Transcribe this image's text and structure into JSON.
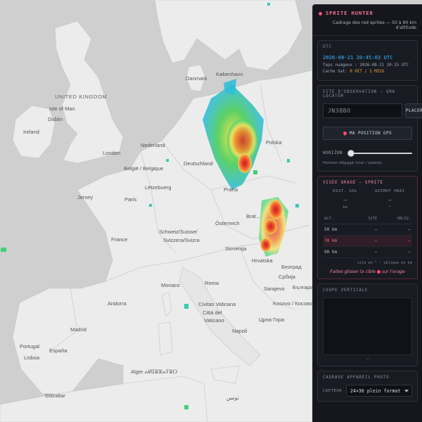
{
  "map": {
    "countries": [
      {
        "id": "uk",
        "label": "UNITED KINGDOM"
      },
      {
        "id": "ireland",
        "label": "Ireland"
      },
      {
        "id": "danmark",
        "label": "Danmark"
      },
      {
        "id": "nederland",
        "label": "Nederland"
      },
      {
        "id": "belgie",
        "label": "België / Belgique"
      },
      {
        "id": "deutschland",
        "label": "Deutschland"
      },
      {
        "id": "polska",
        "label": "Polska"
      },
      {
        "id": "letzebuerg",
        "label": "Lëtzebuerg"
      },
      {
        "id": "france",
        "label": "France"
      },
      {
        "id": "schweiz",
        "label": "Schweiz/Suisse/"
      },
      {
        "id": "svizzera",
        "label": "Svizzera/Svizra"
      },
      {
        "id": "osterreich",
        "label": "Österreich"
      },
      {
        "id": "slovenija",
        "label": "Slovenija"
      },
      {
        "id": "hrvatska",
        "label": "Hrvatska"
      },
      {
        "id": "srbija",
        "label": "Србија"
      },
      {
        "id": "monaco",
        "label": "Monaco"
      },
      {
        "id": "andorra",
        "label": "Andorra"
      },
      {
        "id": "portugal",
        "label": "Portugal"
      },
      {
        "id": "espana",
        "label": "España"
      },
      {
        "id": "civitas",
        "label": "Civitas Vaticana"
      },
      {
        "id": "citta",
        "label": "Città del"
      },
      {
        "id": "vaticano",
        "label": "Vaticano"
      },
      {
        "id": "kosovo",
        "label": "Kosovo / Косово"
      },
      {
        "id": "crnagora",
        "label": "Црна Гора"
      },
      {
        "id": "bulgaria",
        "label": "България"
      },
      {
        "id": "algerie",
        "label": "Alger ⴰⵍⵊⴻⵣⴰⵢⴻⵔ"
      },
      {
        "id": "tunis",
        "label": "تونس"
      }
    ],
    "cities": [
      {
        "id": "kobenhavn",
        "label": "København"
      },
      {
        "id": "isle",
        "label": "Isle of Man"
      },
      {
        "id": "dublin",
        "label": "Dublin"
      },
      {
        "id": "london",
        "label": "London"
      },
      {
        "id": "jersey",
        "label": "Jersey"
      },
      {
        "id": "paris",
        "label": "Paris"
      },
      {
        "id": "praha",
        "label": "Praha"
      },
      {
        "id": "bratislava",
        "label": "Brat..."
      },
      {
        "id": "roma",
        "label": "Roma"
      },
      {
        "id": "madrid",
        "label": "Madrid"
      },
      {
        "id": "lisboa",
        "label": "Lisboa"
      },
      {
        "id": "sarajevo",
        "label": "Sarajevo"
      },
      {
        "id": "beograd",
        "label": "Београд"
      },
      {
        "id": "gibraltar",
        "label": "Gibraltar"
      },
      {
        "id": "napoli",
        "label": "Napoli"
      }
    ]
  },
  "panel": {
    "title": "SPRITE HUNTER",
    "subtitle": "Cadrage des red sprites — 50 à 90 km d'altitude",
    "utc": {
      "section": "UTC",
      "time": "2026-08-21 20:45:03 UTC",
      "clouds": "Tops nuageux : 2026-08-21 20:15 UTC",
      "cache_label": "Cache Sat: ",
      "cache_value": "0 HIT / 1 MISS"
    },
    "site": {
      "section": "SITE D'OBSERVATION — QRA LOCATOR",
      "locator_value": "JN38BO",
      "place_button": "PLACER",
      "gps_button": "MA POSITION GPS",
      "horizon_label": "HORIZON",
      "horizon_value": 0.03,
      "horizon_hint": "Horizon dégagé (mer / plaine)"
    },
    "aim": {
      "section": "VISÉE ORAGE — SPRITE",
      "dist_label": "DIST. SOL",
      "dist_value": "—",
      "dist_unit": "km",
      "azimuth_label": "AZIMUT VRAI",
      "azimuth_value": "—",
      "azimuth_unit": "°",
      "columns": [
        "ALT.",
        "SITE",
        "OBLIQ."
      ],
      "rows": [
        {
          "alt": "50 km",
          "site": "—",
          "obliq": "—",
          "selected": false
        },
        {
          "alt": "70 km",
          "site": "—",
          "obliq": "—",
          "selected": true
        },
        {
          "alt": "90 km",
          "site": "—",
          "obliq": "—",
          "selected": false
        }
      ],
      "table_note": "site en ° · oblique en km",
      "drag_hint_a": "Faites glisser la cible",
      "drag_hint_b": "sur l'orage"
    },
    "coupe": {
      "section": "COUPE VERTICALE",
      "placeholder": "—"
    },
    "camera": {
      "section": "CADRAGE APPAREIL PHOTO",
      "sensor_label": "CAPTEUR",
      "sensor_value": "24×36 plein format"
    }
  }
}
